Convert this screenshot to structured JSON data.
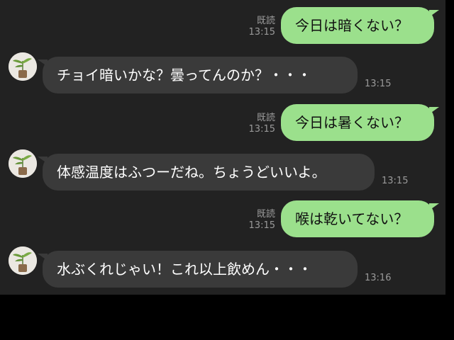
{
  "messages": [
    {
      "direction": "out",
      "text": "今日は暗くない？",
      "read": "既読",
      "time": "13:15"
    },
    {
      "direction": "in",
      "text": "チョイ暗いかな？曇ってんのか？・・・",
      "time": "13:15"
    },
    {
      "direction": "out",
      "text": "今日は暑くない？",
      "read": "既読",
      "time": "13:15"
    },
    {
      "direction": "in",
      "text": "体感温度はふつーだね。ちょうどいいよ。",
      "time": "13:15"
    },
    {
      "direction": "out",
      "text": "喉は乾いてない？",
      "read": "既読",
      "time": "13:15"
    },
    {
      "direction": "in",
      "text": "水ぶくれじゃい！これ以上飲めん・・・",
      "time": "13:16"
    }
  ],
  "colors": {
    "outgoing_bubble": "#9be08c",
    "incoming_bubble": "#3a3a3a",
    "background": "#222222"
  },
  "avatar_icon": "potted-plant-icon"
}
